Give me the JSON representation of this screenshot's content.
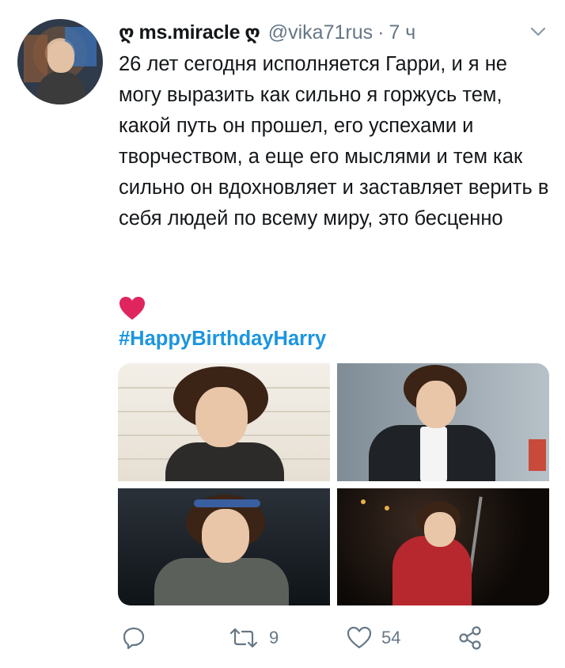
{
  "tweet": {
    "display_name": "ms.miracle",
    "name_decoration_glyph": "ღ",
    "handle": "@vika71rus",
    "separator": "·",
    "time": "7 ч",
    "text": "26 лет сегодня исполняется Гарри, и я не могу выразить как сильно я горжусь тем, какой путь он прошел, его успехами и творчеством, а еще его мыслями и тем как сильно он вдохновляет и заставляет верить в себя людей по всему миру, это бесценно",
    "emoji": "red-heart",
    "hashtag": "#HappyBirthdayHarry",
    "photos": [
      "photo-1",
      "photo-2",
      "photo-3",
      "photo-4"
    ]
  },
  "actions": {
    "reply": {
      "icon": "reply-icon",
      "count": ""
    },
    "retweet": {
      "icon": "retweet-icon",
      "count": "9"
    },
    "like": {
      "icon": "like-icon",
      "count": "54"
    },
    "share": {
      "icon": "share-icon",
      "count": ""
    }
  },
  "colors": {
    "text": "#14171a",
    "secondary": "#657786",
    "link": "#1b95e0",
    "heart": "#e0245e"
  }
}
